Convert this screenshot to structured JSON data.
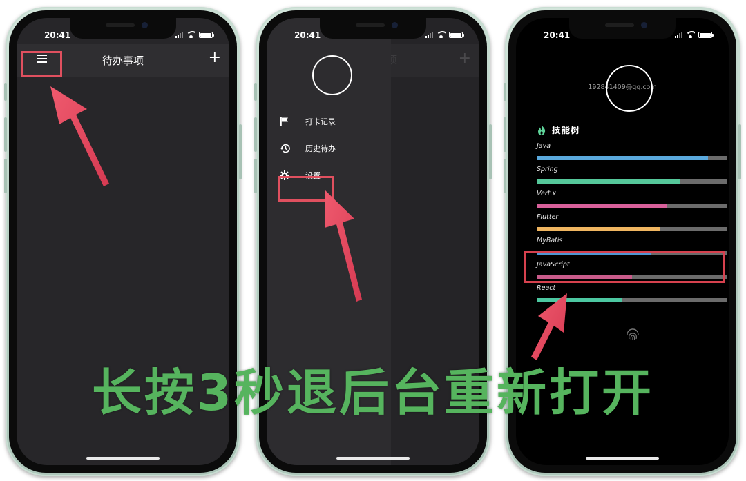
{
  "status_bar": {
    "time": "20:41"
  },
  "phone1": {
    "app_title": "待办事项",
    "add_glyph": "+",
    "menu_icon": "hamburger-menu-icon"
  },
  "phone2": {
    "background_add_glyph": "+",
    "menu_items": [
      {
        "label": "打卡记录",
        "icon": "flag-icon"
      },
      {
        "label": "历史待办",
        "icon": "history-icon"
      },
      {
        "label": "设置",
        "icon": "gear-icon"
      }
    ]
  },
  "phone3": {
    "email": "192841409@qq.com",
    "skills_title": "技能树",
    "skills_icon": "flame-icon",
    "skills": [
      {
        "name": "Java",
        "level": 0.9,
        "color": "#5aa9dd"
      },
      {
        "name": "Spring",
        "level": 0.75,
        "color": "#55c79a"
      },
      {
        "name": "Vert.x",
        "level": 0.68,
        "color": "#d7609a"
      },
      {
        "name": "Flutter",
        "level": 0.65,
        "color": "#efb560"
      },
      {
        "name": "MyBatis",
        "level": 0.6,
        "color": "#4f97d5"
      },
      {
        "name": "JavaScript",
        "level": 0.5,
        "color": "#c95b8a"
      },
      {
        "name": "React",
        "level": 0.45,
        "color": "#4cc7a1"
      }
    ],
    "fingerprint_icon": "fingerprint-icon"
  },
  "annotation_color": "#e0505f",
  "caption": "长按3秒退后台重新打开",
  "caption_color": "#56b45e"
}
